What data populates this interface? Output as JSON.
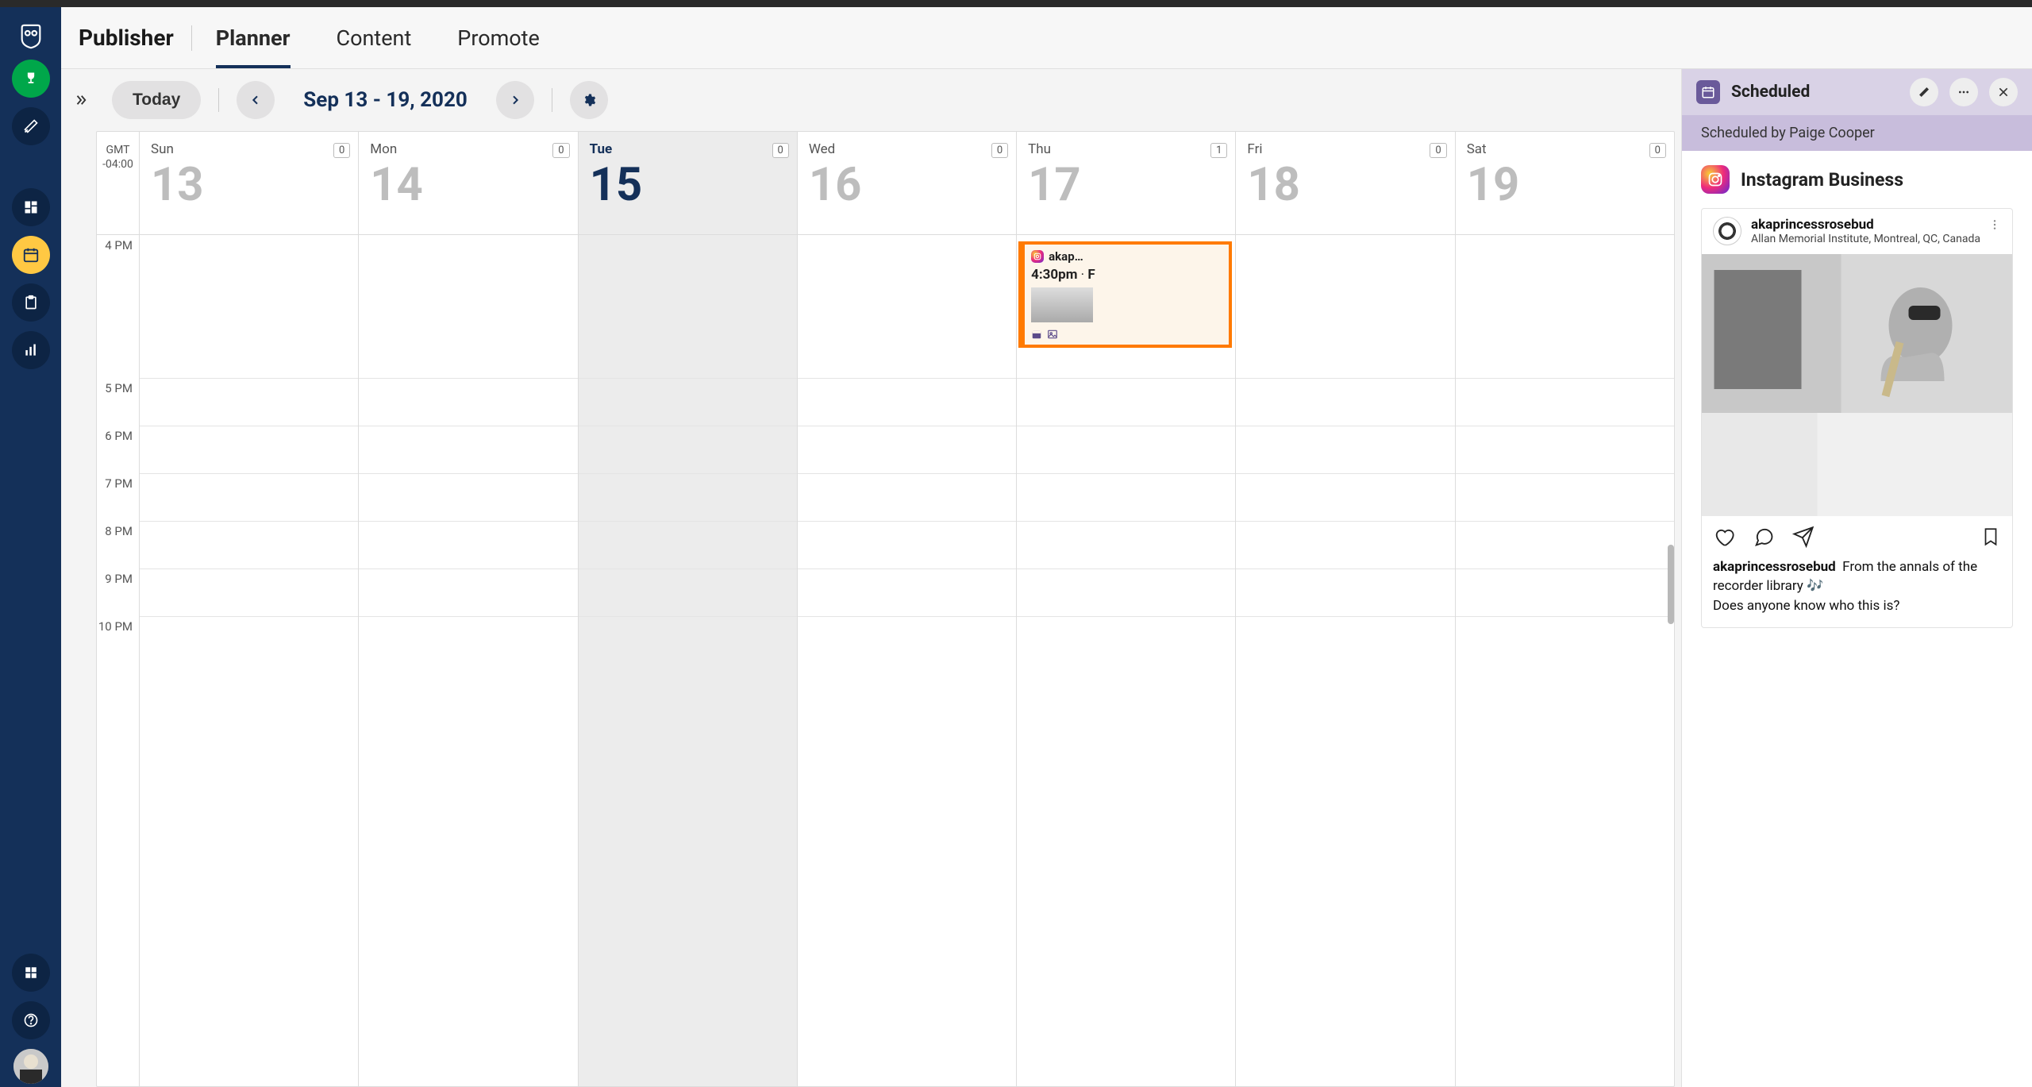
{
  "brand": "Publisher",
  "tabs": [
    {
      "label": "Planner",
      "active": true
    },
    {
      "label": "Content",
      "active": false
    },
    {
      "label": "Promote",
      "active": false
    }
  ],
  "toolbar": {
    "today": "Today",
    "date_range": "Sep 13 - 19, 2020"
  },
  "timezone": {
    "label": "GMT",
    "offset": "-04:00"
  },
  "days": [
    {
      "name": "Sun",
      "num": "13",
      "count": "0",
      "today": false
    },
    {
      "name": "Mon",
      "num": "14",
      "count": "0",
      "today": false
    },
    {
      "name": "Tue",
      "num": "15",
      "count": "0",
      "today": true
    },
    {
      "name": "Wed",
      "num": "16",
      "count": "0",
      "today": false
    },
    {
      "name": "Thu",
      "num": "17",
      "count": "1",
      "today": false
    },
    {
      "name": "Fri",
      "num": "18",
      "count": "0",
      "today": false
    },
    {
      "name": "Sat",
      "num": "19",
      "count": "0",
      "today": false
    }
  ],
  "hours": [
    "4 PM",
    "5 PM",
    "6 PM",
    "7 PM",
    "8 PM",
    "9 PM",
    "10 PM"
  ],
  "event": {
    "account": "akap…",
    "time": "4:30pm",
    "sep": " · ",
    "tail": "F"
  },
  "detail": {
    "status": "Scheduled",
    "byline": "Scheduled by Paige Cooper",
    "network": "Instagram Business",
    "post": {
      "username": "akaprincessrosebud",
      "location": "Allan Memorial Institute, Montreal, QC, Canada",
      "caption_user": "akaprincessrosebud",
      "caption_line1": "From the annals of the recorder library 🎶",
      "caption_line2": "Does anyone know who this is?"
    }
  }
}
